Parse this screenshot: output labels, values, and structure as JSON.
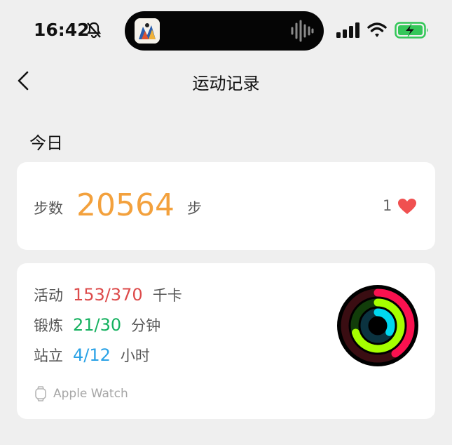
{
  "status_bar": {
    "time": "16:42",
    "icons": [
      "bell-slash-icon",
      "audio-wave-icon",
      "cellular-signal-icon",
      "wifi-icon",
      "battery-charging-icon"
    ],
    "battery_color": "#34c759"
  },
  "nav": {
    "back_icon": "chevron-left-icon",
    "title": "运动记录"
  },
  "today": {
    "title": "今日",
    "steps": {
      "label": "步数",
      "value": "20564",
      "unit": "步",
      "likes": "1",
      "value_color": "#f3a13d",
      "heart_color": "#f05050"
    },
    "activity": {
      "move": {
        "label": "活动",
        "value": "153/370",
        "unit": "千卡",
        "color": "#dd4b4b",
        "progress": 0.41
      },
      "exercise": {
        "label": "锻炼",
        "value": "21/30",
        "unit": "分钟",
        "color": "#15b15f",
        "progress": 0.7
      },
      "stand": {
        "label": "站立",
        "value": "4/12",
        "unit": "小时",
        "color": "#2aa2e6",
        "progress": 0.33
      },
      "source": "Apple Watch"
    }
  }
}
